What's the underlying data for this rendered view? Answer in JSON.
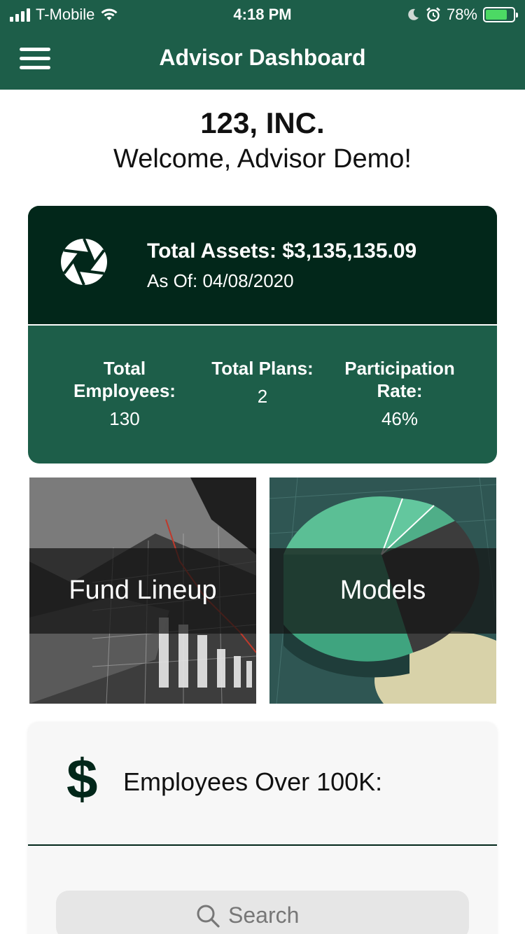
{
  "status_bar": {
    "carrier": "T-Mobile",
    "time": "4:18 PM",
    "battery": "78%",
    "battery_level": 0.78,
    "icons": [
      "signal-icon",
      "wifi-icon",
      "moon-icon",
      "alarm-icon",
      "battery-charging-icon"
    ]
  },
  "header": {
    "title": "Advisor Dashboard",
    "menu_icon": "hamburger-menu-icon",
    "background": "#1d5e49"
  },
  "greeting": {
    "company": "123, INC.",
    "welcome": "Welcome, Advisor Demo!"
  },
  "summary_card": {
    "icon": "aperture-icon",
    "total_assets": "Total Assets: $3,135,135.09",
    "as_of": "As Of: 04/08/2020",
    "stats": [
      {
        "label_line1": "Total",
        "label_line2": "Employees:",
        "value": "130"
      },
      {
        "label_line1": "Total Plans:",
        "label_line2": "",
        "value": "2"
      },
      {
        "label_line1": "Participation",
        "label_line2": "Rate:",
        "value": "46%"
      }
    ],
    "top_color": "#02271a",
    "bottom_color": "#1d5e49"
  },
  "tiles": [
    {
      "label": "Fund Lineup"
    },
    {
      "label": "Models"
    }
  ],
  "employees_card": {
    "icon": "dollar-icon",
    "symbol": "$",
    "title": "Employees Over 100K:",
    "search_placeholder": "Search"
  }
}
